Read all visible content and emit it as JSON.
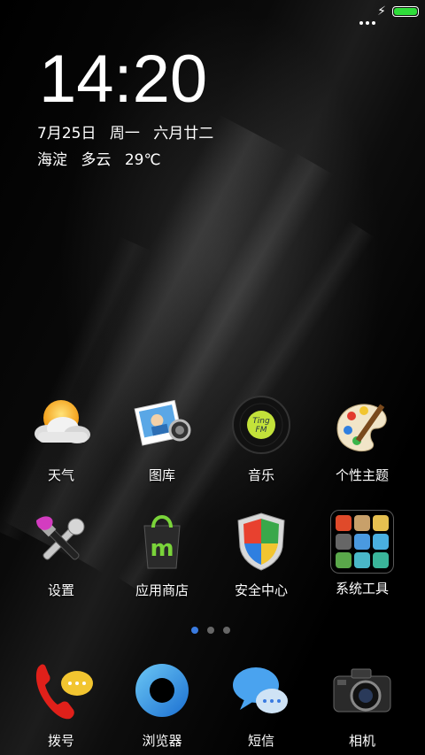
{
  "status_bar": {
    "battery_level": 1.0,
    "battery_color": "#2fdc3a",
    "charging_icon": "lightning-bolt-icon",
    "signal_icon": "signal-dots-icon"
  },
  "clock_widget": {
    "time": "14:20",
    "date": "7月25日",
    "weekday": "周一",
    "lunar_date": "六月廿二",
    "location": "海淀",
    "weather": "多云",
    "temperature": "29℃"
  },
  "apps": [
    {
      "label": "天气",
      "icon": "weather-icon"
    },
    {
      "label": "图库",
      "icon": "gallery-icon"
    },
    {
      "label": "音乐",
      "icon": "music-icon"
    },
    {
      "label": "个性主题",
      "icon": "themes-icon"
    },
    {
      "label": "设置",
      "icon": "settings-icon"
    },
    {
      "label": "应用商店",
      "icon": "app-store-icon"
    },
    {
      "label": "安全中心",
      "icon": "security-center-icon"
    },
    {
      "label": "系统工具",
      "icon": "system-tools-folder-icon"
    }
  ],
  "page_indicator": {
    "pages": 3,
    "current": 1,
    "active_color": "#3a7be0"
  },
  "dock": [
    {
      "label": "拨号",
      "icon": "phone-dialer-icon"
    },
    {
      "label": "浏览器",
      "icon": "browser-icon"
    },
    {
      "label": "短信",
      "icon": "messages-icon"
    },
    {
      "label": "相机",
      "icon": "camera-icon"
    }
  ]
}
